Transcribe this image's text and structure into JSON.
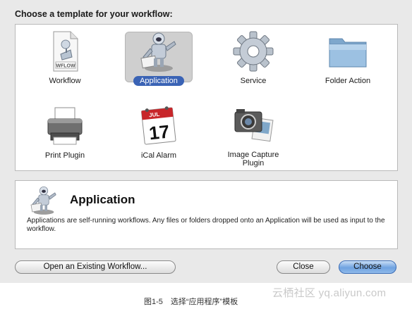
{
  "dialog": {
    "heading": "Choose a template for your workflow:",
    "templates": [
      {
        "label": "Workflow",
        "icon": "wflow-document-icon",
        "selected": false,
        "badge": "WFLOW"
      },
      {
        "label": "Application",
        "icon": "automator-robot-icon",
        "selected": true
      },
      {
        "label": "Service",
        "icon": "gear-icon",
        "selected": false
      },
      {
        "label": "Folder Action",
        "icon": "folder-icon",
        "selected": false
      },
      {
        "label": "Print Plugin",
        "icon": "printer-icon",
        "selected": false
      },
      {
        "label": "iCal Alarm",
        "icon": "calendar-icon",
        "selected": false,
        "month": "JUL",
        "day": "17"
      },
      {
        "label": "Image Capture Plugin",
        "icon": "camera-icon",
        "selected": false
      }
    ],
    "description": {
      "title": "Application",
      "text": "Applications are self-running workflows. Any files or folders dropped onto an Application will be used as input to the workflow."
    },
    "buttons": {
      "open_existing": "Open an Existing Workflow...",
      "close": "Close",
      "choose": "Choose"
    },
    "colors": {
      "selection": "#3a63b5",
      "default_button": "#6fa2e0"
    }
  },
  "caption": "图1-5　选择“应用程序”模板",
  "watermark": "云栖社区 yq.aliyun.com"
}
